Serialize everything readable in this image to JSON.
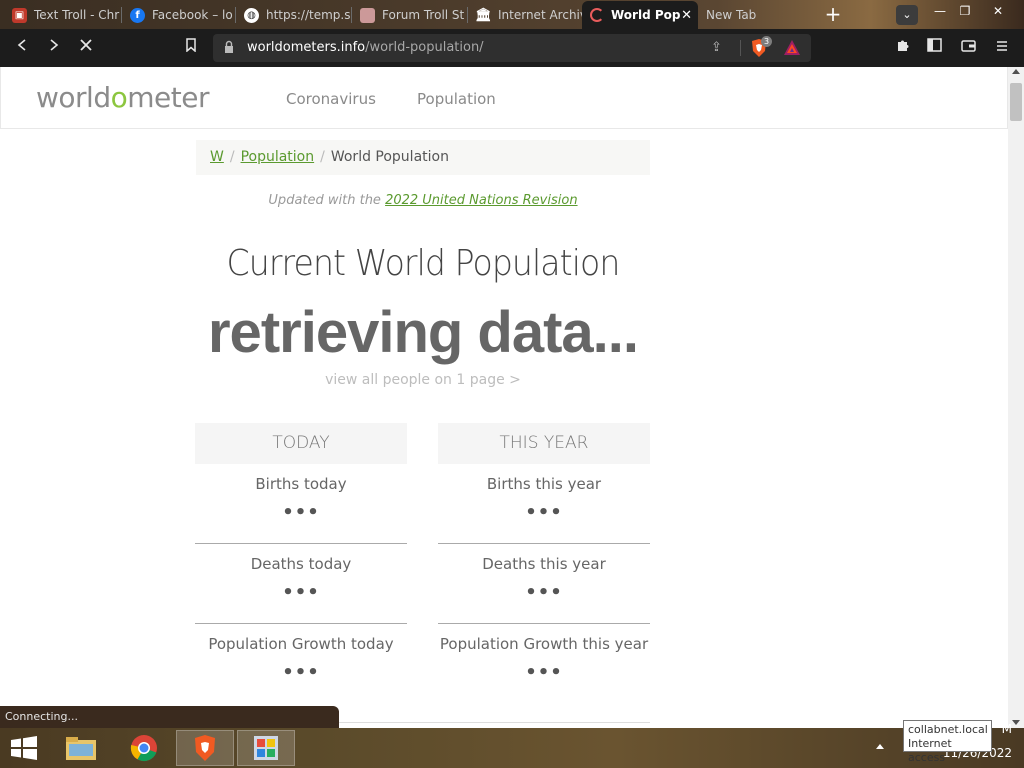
{
  "browser": {
    "tabs": [
      {
        "title": "Text Troll - Chr",
        "icon": "app-icon",
        "color": "#c0392b"
      },
      {
        "title": "Facebook – lo",
        "icon": "facebook-icon",
        "color": "#1877f2"
      },
      {
        "title": "https://temp.sl",
        "icon": "globe-icon",
        "color": "#ffffff"
      },
      {
        "title": "Forum Troll St",
        "icon": "image-icon",
        "color": "#d7a7a7"
      },
      {
        "title": "Internet Archiv",
        "icon": "archive-icon",
        "color": "#ffffff"
      },
      {
        "title": "World Pop",
        "icon": "loading-icon",
        "color": "#e85c5c"
      },
      {
        "title": "New Tab",
        "icon": "",
        "color": ""
      }
    ],
    "new_tab": "+",
    "tab_search": "⌄",
    "window": {
      "min": "—",
      "restore": "❐",
      "close": "✕"
    },
    "url_domain": "worldometers.info",
    "url_path": "/world-population/",
    "shield_count": "3",
    "status": "Connecting..."
  },
  "site": {
    "logo_a": "world",
    "logo_o": "o",
    "logo_b": "meter",
    "nav": [
      "Coronavirus",
      "Population"
    ],
    "breadcrumb": {
      "home": "W",
      "section": "Population",
      "current": "World Population"
    },
    "updated_prefix": "Updated with the ",
    "updated_link": "2022 United Nations Revision",
    "heading": "Current World Population",
    "counter": "retrieving data...",
    "view_all": "view all people on 1 page >",
    "today": {
      "head": "TODAY",
      "stats": [
        {
          "label": "Births today",
          "value": "•••"
        },
        {
          "label": "Deaths today",
          "value": "•••"
        },
        {
          "label": "Population Growth today",
          "value": "•••"
        }
      ]
    },
    "this_year": {
      "head": "THIS YEAR",
      "stats": [
        {
          "label": "Births this year",
          "value": "•••"
        },
        {
          "label": "Deaths this year",
          "value": "•••"
        },
        {
          "label": "Population Growth this year",
          "value": "•••"
        }
      ]
    }
  },
  "taskbar": {
    "tooltip_line1": "collabnet.local",
    "tooltip_line2": "Internet access",
    "time": "M",
    "date": "11/26/2022"
  }
}
